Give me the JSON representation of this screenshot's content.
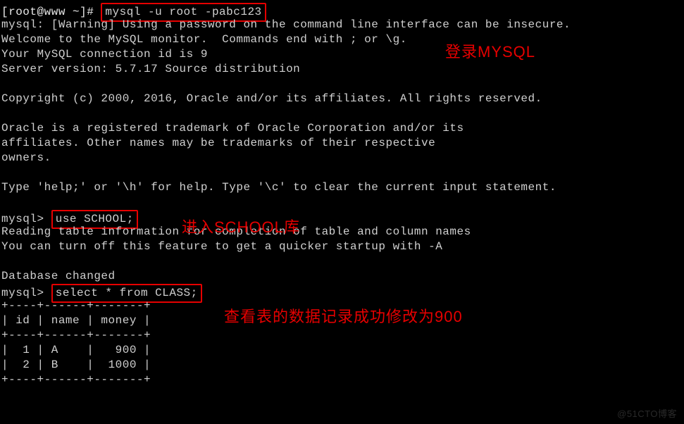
{
  "prompt1": {
    "user_host": "[root@www ~]# ",
    "command": "mysql -u root -pabc123"
  },
  "mysql_output": {
    "warning": "mysql: [Warning] Using a password on the command line interface can be insecure.",
    "welcome": "Welcome to the MySQL monitor.  Commands end with ; or \\g.",
    "connection": "Your MySQL connection id is 9",
    "version": "Server version: 5.7.17 Source distribution",
    "copyright": "Copyright (c) 2000, 2016, Oracle and/or its affiliates. All rights reserved.",
    "trademark1": "Oracle is a registered trademark of Oracle Corporation and/or its",
    "trademark2": "affiliates. Other names may be trademarks of their respective",
    "trademark3": "owners.",
    "help": "Type 'help;' or '\\h' for help. Type '\\c' to clear the current input statement."
  },
  "prompt2": {
    "prefix": "mysql> ",
    "command": "use SCHOOL;"
  },
  "use_output": {
    "reading": "Reading table information for completion of table and column names",
    "turnoff": "You can turn off this feature to get a quicker startup with -A",
    "changed": "Database changed"
  },
  "prompt3": {
    "prefix": "mysql> ",
    "command": "select * from CLASS;"
  },
  "table": {
    "border": "+----+------+-------+",
    "header": "| id | name | money |",
    "row1": "|  1 | A    |   900 |",
    "row2": "|  2 | B    |  1000 |"
  },
  "annotations": {
    "login": "登录MYSQL",
    "enter_db": "进入SCHOOL库",
    "view_table": "查看表的数据记录成功修改为900"
  },
  "watermark": "@51CTO博客"
}
